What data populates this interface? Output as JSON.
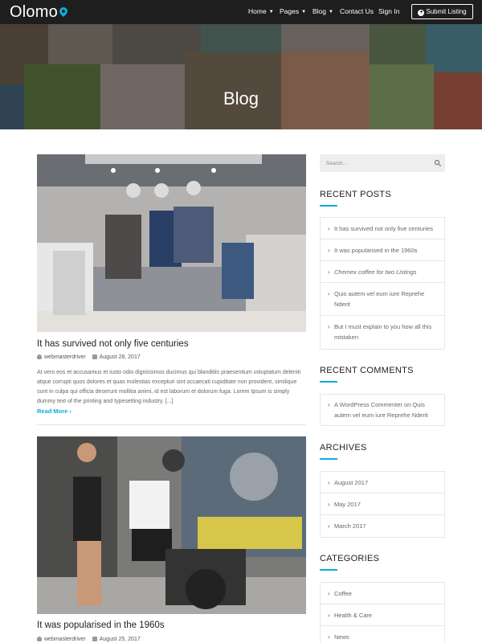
{
  "header": {
    "logo": "Olomo",
    "nav": [
      {
        "label": "Home",
        "has_dropdown": true
      },
      {
        "label": "Pages",
        "has_dropdown": true
      },
      {
        "label": "Blog",
        "has_dropdown": true
      },
      {
        "label": "Contact Us",
        "has_dropdown": false
      },
      {
        "label": "Sign In",
        "has_dropdown": false
      }
    ],
    "submit_label": "Submit Listing"
  },
  "hero": {
    "title": "Blog"
  },
  "posts": [
    {
      "title": "It has survived not only five centuries",
      "author": "webmasterdriver",
      "date": "August 28, 2017",
      "excerpt": "At vero eos et accusamus et iusto odio dignissimos ducimus qui blanditiis praesentium voluptatum deleniti atque corrupti quos dolores et quas molestias excepturi sint occaecati cupiditate non provident, similique sunt in culpa qui officia deserunt mollitia animi, id est laborum et dolorum fuga. Lorem Ipsum is simply dummy text of the printing and typesetting industry. [...]",
      "read_more": "Read More ›"
    },
    {
      "title": "It was popularised in the 1960s",
      "author": "webmasterdriver",
      "date": "August 25, 2017"
    }
  ],
  "sidebar": {
    "search_placeholder": "Search...",
    "recent_posts": {
      "title": "RECENT POSTS",
      "items": [
        "It has survived not only five centuries",
        "It was popularised in the 1960s",
        "Chemex coffee for two Listings",
        "Quis autem vel eum iure Reprehe Nderit",
        "But I must explain to you how all this mistaken"
      ]
    },
    "recent_comments": {
      "title": "RECENT COMMENTS",
      "items": [
        "A WordPress Commenter on Quis autem vel eum iure Reprehe Nderit"
      ]
    },
    "archives": {
      "title": "ARCHIVES",
      "items": [
        "August 2017",
        "May 2017",
        "March 2017"
      ]
    },
    "categories": {
      "title": "CATEGORIES",
      "items": [
        "Coffee",
        "Health & Care",
        "News"
      ]
    }
  },
  "colors": {
    "accent": "#0aaee0",
    "header_bg": "#1e1e1e"
  }
}
